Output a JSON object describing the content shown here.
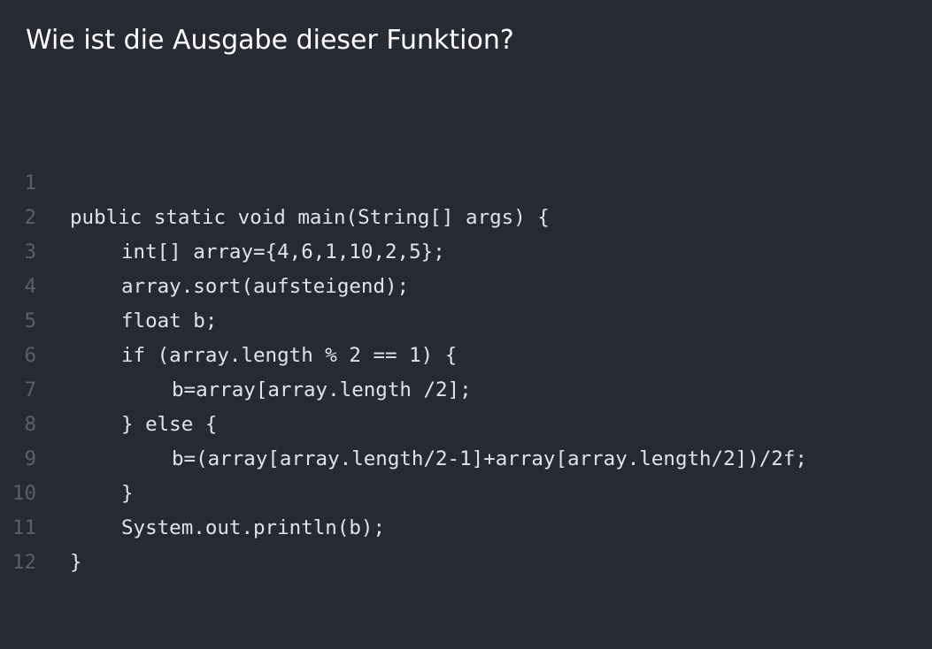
{
  "question": "Wie ist die Ausgabe dieser Funktion?",
  "code": {
    "lines": [
      {
        "number": "1",
        "text": "public static void main(String[] args) {"
      },
      {
        "number": "2",
        "text": "int[] array={4,6,1,10,2,5};"
      },
      {
        "number": "3",
        "text": "array.sort(aufsteigend);"
      },
      {
        "number": "4",
        "text": "float b;"
      },
      {
        "number": "5",
        "text": "if (array.length % 2 == 1) {"
      },
      {
        "number": "6",
        "text": "b=array[array.length /2];"
      },
      {
        "number": "7",
        "text": "} else {"
      },
      {
        "number": "8",
        "text": "b=(array[array.length/2-1]+array[array.length/2])/2f;"
      },
      {
        "number": "9",
        "text": "}"
      },
      {
        "number": "10",
        "text": "System.out.println(b);"
      },
      {
        "number": "11",
        "text": "}"
      },
      {
        "number": "12",
        "text": ""
      }
    ]
  },
  "colors": {
    "background": "#282a33",
    "code_text": "#e1e3e8",
    "line_number": "#5b5f69",
    "heading": "#ffffff"
  }
}
